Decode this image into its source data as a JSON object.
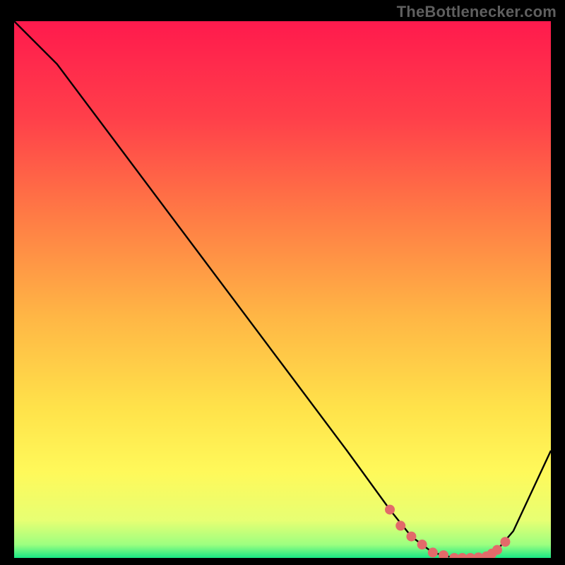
{
  "attribution": "TheBottlenecker.com",
  "chart_data": {
    "type": "line",
    "title": "",
    "xlabel": "",
    "ylabel": "",
    "xlim": [
      0,
      100
    ],
    "ylim": [
      0,
      100
    ],
    "grid": false,
    "series": [
      {
        "name": "curve",
        "x": [
          0,
          8,
          20,
          35,
          50,
          62,
          70,
          74,
          78,
          82,
          85,
          88,
          90,
          93,
          100
        ],
        "y": [
          100,
          92,
          76,
          56,
          36,
          20,
          9,
          4,
          1,
          0,
          0,
          0.3,
          1.5,
          5,
          20
        ]
      }
    ],
    "markers": {
      "name": "dots",
      "x": [
        70,
        72,
        74,
        76,
        78,
        80,
        82,
        83.5,
        85,
        86.5,
        88,
        89,
        90,
        91.5
      ],
      "y": [
        9,
        6,
        4,
        2.5,
        1,
        0.5,
        0,
        0,
        0,
        0.1,
        0.3,
        0.8,
        1.5,
        3
      ]
    },
    "background_gradient": {
      "stops": [
        {
          "offset": 0.0,
          "color": "#ff1a4d"
        },
        {
          "offset": 0.18,
          "color": "#ff3f4a"
        },
        {
          "offset": 0.36,
          "color": "#ff7a45"
        },
        {
          "offset": 0.55,
          "color": "#ffb645"
        },
        {
          "offset": 0.72,
          "color": "#ffe24a"
        },
        {
          "offset": 0.84,
          "color": "#fff95a"
        },
        {
          "offset": 0.93,
          "color": "#e7ff73"
        },
        {
          "offset": 0.975,
          "color": "#9dff80"
        },
        {
          "offset": 1.0,
          "color": "#18e884"
        }
      ]
    },
    "line_color": "#000000",
    "marker_color": "#e26a6a",
    "marker_radius": 7
  }
}
